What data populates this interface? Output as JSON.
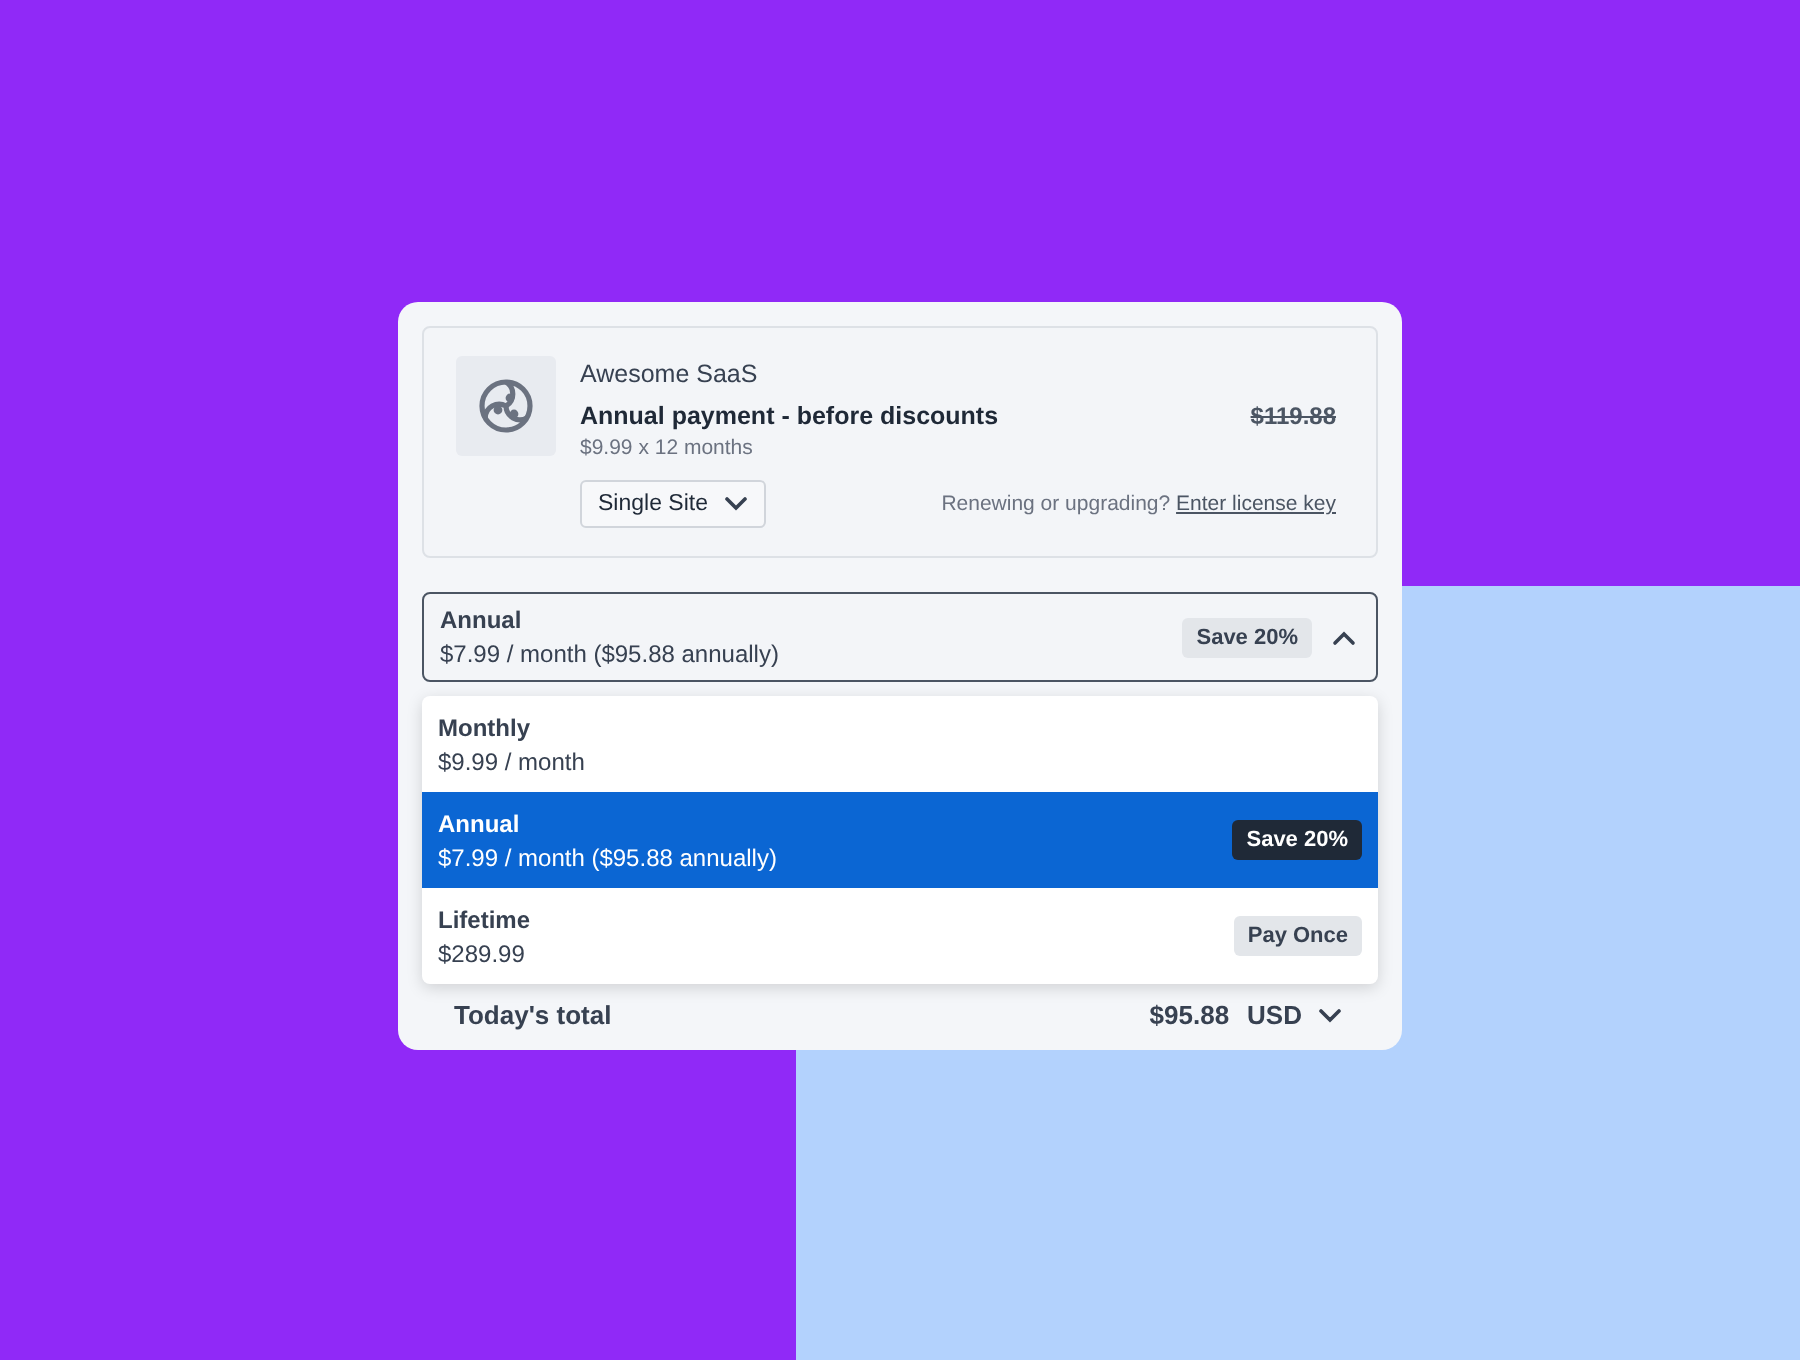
{
  "product": {
    "name": "Awesome SaaS",
    "title": "Annual payment - before discounts",
    "detail": "$9.99 x 12 months",
    "price_original": "$119.88",
    "variant": "Single Site",
    "renewing_text": "Renewing or upgrading?",
    "license_link": "Enter license key"
  },
  "plan_select": {
    "label": "Annual",
    "detail": "$7.99 / month ($95.88 annually)",
    "badge": "Save 20%",
    "expanded": true
  },
  "plan_options": [
    {
      "label": "Monthly",
      "detail": "$9.99 / month",
      "selected": false
    },
    {
      "label": "Annual",
      "detail": "$7.99 / month ($95.88 annually)",
      "badge": "Save 20%",
      "selected": true
    },
    {
      "label": "Lifetime",
      "detail": "$289.99",
      "badge": "Pay Once",
      "selected": false
    }
  ],
  "total": {
    "label": "Today's total",
    "amount": "$95.88",
    "currency": "USD"
  }
}
